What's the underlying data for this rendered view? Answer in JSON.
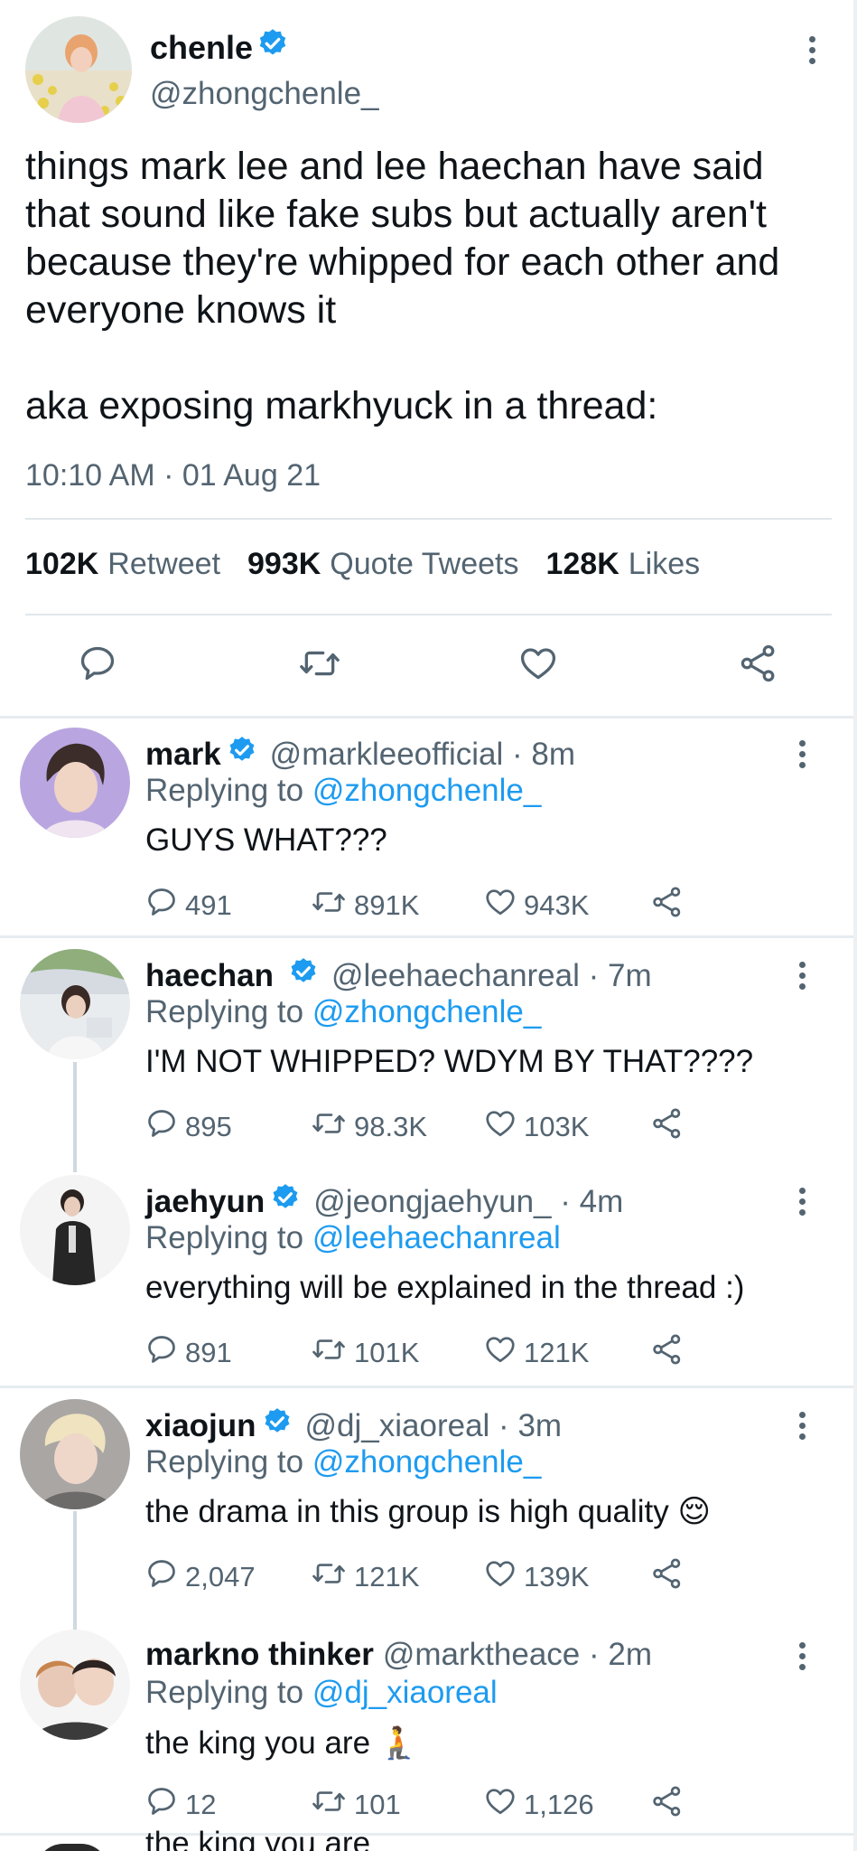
{
  "main_tweet": {
    "author": {
      "display_name": "chenle",
      "handle": "@zhongchenle_"
    },
    "text_lines": [
      "things mark lee and lee haechan have said",
      "that sound like fake subs but actually aren't",
      "because they're whipped for each other and",
      "everyone knows it"
    ],
    "text_second": "aka exposing markhyuck in a thread:",
    "timestamp": "10:10 AM · 01 Aug 21",
    "stats": [
      {
        "value": "102K",
        "label": "Retweet"
      },
      {
        "value": "993K",
        "label": "Quote Tweets"
      },
      {
        "value": "128K",
        "label": "Likes"
      }
    ],
    "actions": [
      "reply-icon",
      "retweet-icon",
      "like-icon",
      "share-icon"
    ]
  },
  "replies": [
    {
      "display_name": "mark",
      "handle": "@markleeofficial · 8m",
      "verified": true,
      "replying_prefix": "Replying to",
      "replying_to": "@zhongchenle_",
      "text": "GUYS WHAT???",
      "replies": "491",
      "retweets": "891K",
      "likes": "943K"
    },
    {
      "display_name": "haechan",
      "handle": "@leehaechanreal · 7m",
      "verified": true,
      "replying_prefix": "Replying to",
      "replying_to": "@zhongchenle_",
      "text": "I'M NOT WHIPPED? WDYM BY THAT????",
      "replies": "895",
      "retweets": "98.3K",
      "likes": "103K"
    },
    {
      "display_name": "jaehyun",
      "handle": "@jeongjaehyun_ · 4m",
      "verified": true,
      "replying_prefix": "Replying to",
      "replying_to": "@leehaechanreal",
      "text": "everything will be explained in the thread :)",
      "replies": "891",
      "retweets": "101K",
      "likes": "121K"
    },
    {
      "display_name": "xiaojun",
      "handle": "@dj_xiaoreal · 3m",
      "verified": true,
      "replying_prefix": "Replying to",
      "replying_to": "@zhongchenle_",
      "text": "the drama in this group is high quality 😌",
      "replies": "2,047",
      "retweets": "121K",
      "likes": "139K"
    },
    {
      "display_name": "markno thinker",
      "handle": "@marktheace · 2m",
      "verified": false,
      "replying_prefix": "Replying to",
      "replying_to": "@dj_xiaoreal",
      "text": "the king you are 🧎",
      "replies": "12",
      "retweets": "101",
      "likes": "1,126"
    }
  ],
  "cut_off_text": "the king you are",
  "colors": {
    "primary_text": "#0f1419",
    "secondary_text": "#536471",
    "link_blue": "#1d9bf0",
    "verified_blue": "#1d9bf0",
    "divider": "#e6ecf0"
  }
}
